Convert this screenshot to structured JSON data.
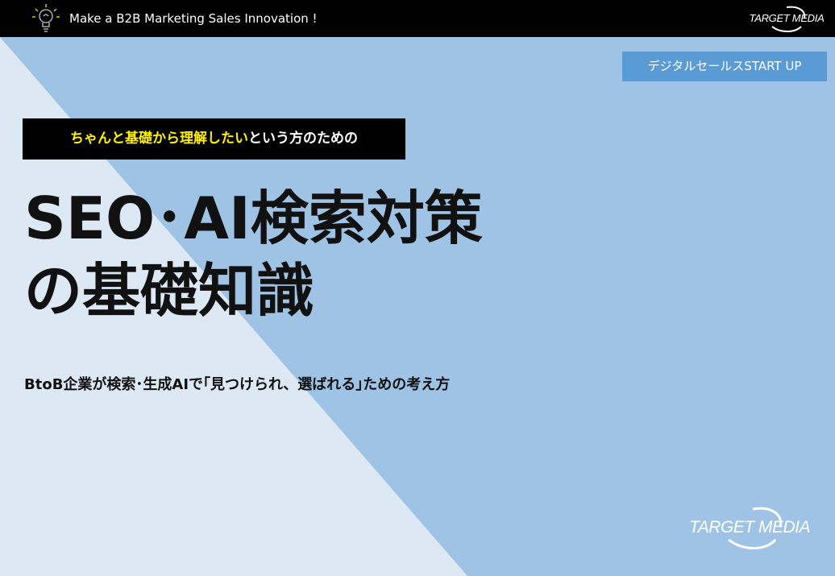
{
  "header": {
    "tagline": "Make a B2B Marketing Sales Innovation !",
    "logo_text": "TARGET MEDIA"
  },
  "series_label": "デジタルセールスSTART UP",
  "lead": {
    "highlight": "ちゃんと基礎から理解したい",
    "rest": "という方のための"
  },
  "title": {
    "line1": "SEO･AI検索対策",
    "line2": "の基礎知識"
  },
  "subtitle": "BtoB企業が検索･生成AIで｢見つけられ、選ばれる｣ための考え方",
  "footer": {
    "logo_text": "TARGET MEDIA"
  },
  "colors": {
    "topbar": "#000000",
    "background_blue": "#9fc3e5",
    "background_light": "#dde8f5",
    "series_label_bg": "#5b9bd5",
    "lead_highlight": "#fff200"
  }
}
